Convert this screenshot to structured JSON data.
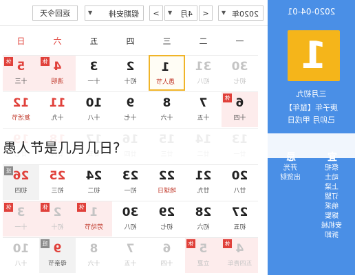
{
  "sidebar": {
    "date": "2020-04-01",
    "day": "1",
    "lunar_date": "三月初九",
    "ganzhi_year": "庚子年【鼠年】",
    "ganzhi_month": "己卯月 甲戌日",
    "yi_head": "宜",
    "ji_head": "忌",
    "yi_items": [
      "祭祀",
      "动土",
      "上梁",
      "订盟",
      "纳采",
      "嫁娶",
      "安机械",
      "拆卸"
    ],
    "ji_items": [
      "开光",
      "出货财"
    ]
  },
  "toolbar": {
    "year_value": "2020年",
    "prev_label": "<",
    "month_value": "4月",
    "next_label": ">",
    "holiday_value": "假期安排",
    "back_today_label": "返回今天",
    "caret": "▼"
  },
  "weekdays": [
    "一",
    "二",
    "三",
    "四",
    "五",
    "六",
    "日"
  ],
  "rest_badge": "休",
  "work_badge": "班",
  "weeks": [
    [
      {
        "num": "30",
        "lunar": "初七",
        "faded": true
      },
      {
        "num": "31",
        "lunar": "初八",
        "faded": true
      },
      {
        "num": "1",
        "lunar": "愚人节",
        "today": true,
        "festival": true
      },
      {
        "num": "2",
        "lunar": "初十"
      },
      {
        "num": "3",
        "lunar": "十一"
      },
      {
        "num": "4",
        "lunar": "清明",
        "rest": true,
        "festival": true
      },
      {
        "num": "5",
        "lunar": "十三",
        "rest": true
      }
    ],
    [
      {
        "num": "6",
        "lunar": "十四",
        "rest": true
      },
      {
        "num": "7",
        "lunar": "十五"
      },
      {
        "num": "8",
        "lunar": "十六"
      },
      {
        "num": "9",
        "lunar": "十七"
      },
      {
        "num": "10",
        "lunar": "十八"
      },
      {
        "num": "11",
        "lunar": "十九"
      },
      {
        "num": "12",
        "lunar": "复活节",
        "festival": true
      }
    ],
    [
      {
        "num": "13",
        "lunar": "廿一"
      },
      {
        "num": "14",
        "lunar": "廿二"
      },
      {
        "num": "15",
        "lunar": "廿三"
      },
      {
        "num": "16",
        "lunar": "廿四"
      },
      {
        "num": "17",
        "lunar": "廿五"
      },
      {
        "num": "18",
        "lunar": "廿六"
      },
      {
        "num": "19",
        "lunar": "廿七"
      }
    ],
    [
      {
        "num": "20",
        "lunar": "廿八"
      },
      {
        "num": "21",
        "lunar": "廿九"
      },
      {
        "num": "22",
        "lunar": "地球日",
        "festival": true
      },
      {
        "num": "23",
        "lunar": "初一"
      },
      {
        "num": "24",
        "lunar": "初二"
      },
      {
        "num": "25",
        "lunar": "初三"
      },
      {
        "num": "26",
        "lunar": "初四",
        "work": true
      }
    ],
    [
      {
        "num": "27",
        "lunar": "初五"
      },
      {
        "num": "28",
        "lunar": "初六"
      },
      {
        "num": "29",
        "lunar": "初七"
      },
      {
        "num": "30",
        "lunar": "初八"
      },
      {
        "num": "1",
        "lunar": "劳动节",
        "rest": true,
        "faded": true,
        "festival": true
      },
      {
        "num": "2",
        "lunar": "初十",
        "rest": true,
        "faded": true
      },
      {
        "num": "3",
        "lunar": "十一",
        "rest": true,
        "faded": true
      }
    ],
    [
      {
        "num": "4",
        "lunar": "五四青年",
        "rest": true,
        "faded": true
      },
      {
        "num": "5",
        "lunar": "立夏",
        "rest": true,
        "faded": true
      },
      {
        "num": "6",
        "lunar": "十四",
        "faded": true
      },
      {
        "num": "7",
        "lunar": "十五",
        "faded": true
      },
      {
        "num": "8",
        "lunar": "十六",
        "faded": true
      },
      {
        "num": "9",
        "lunar": "母亲节",
        "work": true
      },
      {
        "num": "10",
        "lunar": "十八",
        "faded": true
      }
    ]
  ],
  "question": "愚人节是几月几日?"
}
